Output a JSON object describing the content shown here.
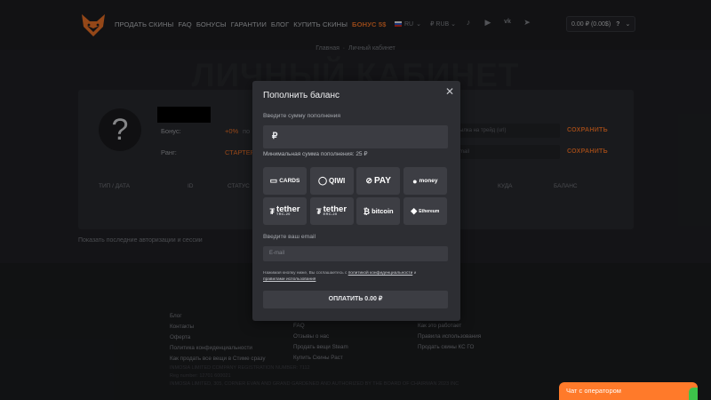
{
  "header": {
    "nav": [
      "ПРОДАТЬ СКИНЫ",
      "FAQ",
      "БОНУСЫ",
      "ГАРАНТИИ",
      "БЛОГ",
      "КУПИТЬ СКИНЫ"
    ],
    "bonus_label": "БОНУС 5$",
    "language": "RU",
    "currency": "₽ RUB",
    "balance": "0.00 ₽ (0.00$)",
    "help": "?",
    "social_icons": [
      "tiktok-icon",
      "youtube-icon",
      "vk-icon",
      "telegram-icon"
    ]
  },
  "page": {
    "breadcrumb_home": "Главная",
    "breadcrumb_current": "Личный кабинет",
    "big_title": "ЛИЧНЫЙ КАБИНЕТ"
  },
  "profile": {
    "avatar_glyph": "?",
    "bonus_label": "Бонус:",
    "bonus_value": "+0%",
    "bonus_more": "по",
    "rank_label": "Ранг:",
    "rank_value": "СТАРТЕР",
    "trade_placeholder": "ссылка на трейд (url)",
    "email_placeholder": "E-mail",
    "save_label": "СОХРАНИТЬ",
    "table_headers": [
      "ТИП / ДАТА",
      "ID",
      "СТАТУС",
      "КУДА",
      "БАЛАНС"
    ],
    "sessions_link": "Показать последние авторизации и сессии"
  },
  "footer": {
    "col1": [
      "Блог",
      "Контакты",
      "Оферта",
      "Политика конфиденциальности",
      "Как продать все вещи в Стиме сразу"
    ],
    "col2": [
      "FAQ",
      "Отзывы о нас",
      "Продать вещи Steam",
      "Купить Скины Раст"
    ],
    "col3": [
      "Как это работает",
      "Правила использования",
      "Продать скины КС ГО"
    ],
    "company": "INMOSIA LIMITED COMPANY REGISTRATION NUMBER: 7112",
    "reg": "Reg number: 12701 600021",
    "legal": "INMOSIA LIMITED, 305, CORNER EVAN AND GRAND GARDENED AND AUTHORIZED BY THE BOARD OF CHAIRMAN 2023 INC"
  },
  "chat": {
    "label": "Чат с оператором"
  },
  "modal": {
    "title": "Пополнить баланс",
    "amount_label": "Введите сумму пополнения",
    "amount_value": "",
    "currency_symbol": "₽",
    "min_amount": "Минимальная сумма пополнения: 25 ₽",
    "methods": [
      {
        "label": "CARDS",
        "icon": "card-icon"
      },
      {
        "label": "QIWI",
        "icon": "qiwi-icon"
      },
      {
        "label": "PAY",
        "icon": "gpay-icon"
      },
      {
        "label": "money",
        "icon": "yoomoney-icon"
      },
      {
        "label": "tether",
        "sub": "TRC-20",
        "icon": "tether-icon"
      },
      {
        "label": "tether",
        "sub": "ERC-20",
        "icon": "tether-icon"
      },
      {
        "label": "bitcoin",
        "icon": "bitcoin-icon"
      },
      {
        "label": "Ethereum",
        "icon": "ethereum-icon"
      }
    ],
    "email_label": "Введите ваш email",
    "email_placeholder": "E-mail",
    "legal_prefix": "Нажимая кнопку ниже, Вы соглашаетесь с ",
    "legal_link1": "политикой конфиденциальности",
    "legal_and": " и ",
    "legal_link2": "правилами использования",
    "pay_button": "ОПЛАТИТЬ 0.00 ₽",
    "close_glyph": "✕"
  },
  "colors": {
    "accent": "#ff7a2a",
    "background": "#232428",
    "modal": "#2d2e33",
    "chat_green": "#3dc34a"
  }
}
